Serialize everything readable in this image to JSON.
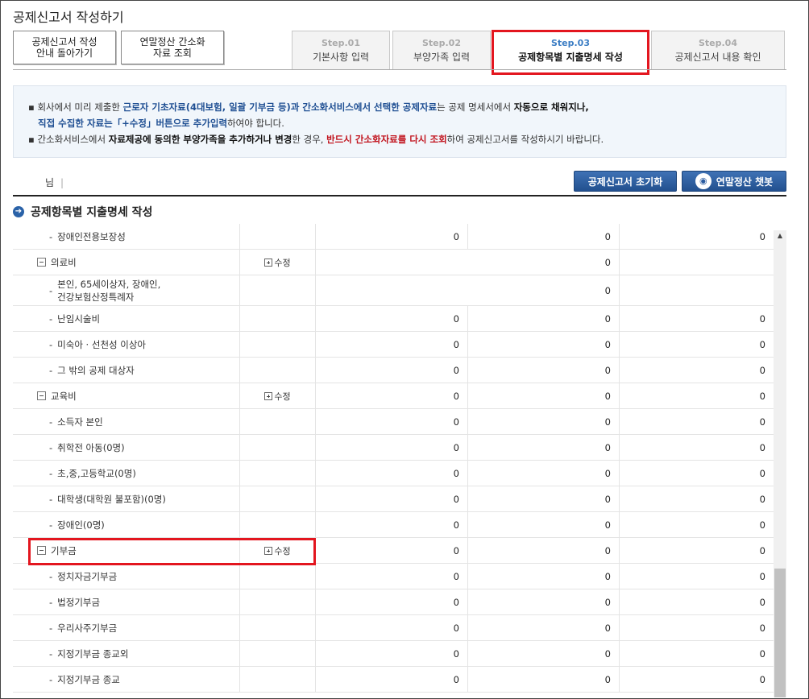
{
  "page_title": "공제신고서 작성하기",
  "top_buttons": {
    "back_line1": "공제신고서 작성",
    "back_line2": "안내 돌아가기",
    "lookup_line1": "연말정산 간소화",
    "lookup_line2": "자료 조회"
  },
  "steps": [
    {
      "num": "Step.01",
      "label": "기본사항 입력"
    },
    {
      "num": "Step.02",
      "label": "부양가족 입력"
    },
    {
      "num": "Step.03",
      "label": "공제항목별 지출명세 작성",
      "active": true
    },
    {
      "num": "Step.04",
      "label": "공제신고서 내용 확인"
    }
  ],
  "info": {
    "l1_a": "회사에서 미리 제출한 ",
    "l1_b": "근로자 기초자료(4대보험, 일괄 기부금 등)과 간소화서비스에서 선택한 공제자료",
    "l1_c": "는 공제 명세서에서 ",
    "l1_d": "자동으로 채워지나,",
    "l2_a": "직접 수집한 자료는「+수정」버튼으로 추가입력",
    "l2_b": "하여야 합니다.",
    "l3_a": "간소화서비스에서 ",
    "l3_b": "자료제공에 동의한 부양가족을 추가하거나 변경",
    "l3_c": "한 경우, ",
    "l3_d": "반드시 간소화자료를 다시 조회",
    "l3_e": "하여 공제신고서를 작성하시기 바랍니다."
  },
  "user": {
    "suffix": "님",
    "separator": "|"
  },
  "actions": {
    "reset": "공제신고서 초기화",
    "chatbot": "연말정산 챗봇"
  },
  "section_title": "공제항목별 지출명세 작성",
  "edit_label": "수정",
  "rows": [
    {
      "label": "장애인전용보장성",
      "type": "sub",
      "v1": "0",
      "v2": "0",
      "v3": "0"
    },
    {
      "label": "의료비",
      "type": "group",
      "edit": true,
      "v1": "",
      "v2": "0",
      "v3": ""
    },
    {
      "label": "본인, 65세이상자, 장애인,",
      "label2": "건강보험산정특례자",
      "type": "sub2",
      "v1": "",
      "v2": "0",
      "v3": ""
    },
    {
      "label": "난임시술비",
      "type": "sub",
      "v1": "0",
      "v2": "0",
      "v3": "0"
    },
    {
      "label": "미숙아 · 선천성 이상아",
      "type": "sub",
      "v1": "0",
      "v2": "0",
      "v3": "0"
    },
    {
      "label": "그 밖의 공제 대상자",
      "type": "sub",
      "v1": "0",
      "v2": "0",
      "v3": "0"
    },
    {
      "label": "교육비",
      "type": "group",
      "edit": true,
      "v1": "0",
      "v2": "0",
      "v3": "0"
    },
    {
      "label": "소득자 본인",
      "type": "sub",
      "v1": "0",
      "v2": "0",
      "v3": "0"
    },
    {
      "label": "취학전 아동(0명)",
      "type": "sub",
      "v1": "0",
      "v2": "0",
      "v3": "0"
    },
    {
      "label": "초,중,고등학교(0명)",
      "type": "sub",
      "v1": "0",
      "v2": "0",
      "v3": "0"
    },
    {
      "label": "대학생(대학원 불포함)(0명)",
      "type": "sub",
      "v1": "0",
      "v2": "0",
      "v3": "0"
    },
    {
      "label": "장애인(0명)",
      "type": "sub",
      "v1": "0",
      "v2": "0",
      "v3": "0"
    },
    {
      "label": "기부금",
      "type": "group",
      "edit": true,
      "v1": "0",
      "v2": "0",
      "v3": "0"
    },
    {
      "label": "정치자금기부금",
      "type": "sub",
      "v1": "0",
      "v2": "0",
      "v3": "0"
    },
    {
      "label": "법정기부금",
      "type": "sub",
      "v1": "0",
      "v2": "0",
      "v3": "0"
    },
    {
      "label": "우리사주기부금",
      "type": "sub",
      "v1": "0",
      "v2": "0",
      "v3": "0"
    },
    {
      "label": "지정기부금 종교외",
      "type": "sub",
      "v1": "0",
      "v2": "0",
      "v3": "0"
    },
    {
      "label": "지정기부금 종교",
      "type": "sub",
      "v1": "0",
      "v2": "0",
      "v3": "0"
    }
  ],
  "colors": {
    "highlight": "#e3161f",
    "primary": "#2a5ba0",
    "step_active": "#3b7dc4"
  }
}
